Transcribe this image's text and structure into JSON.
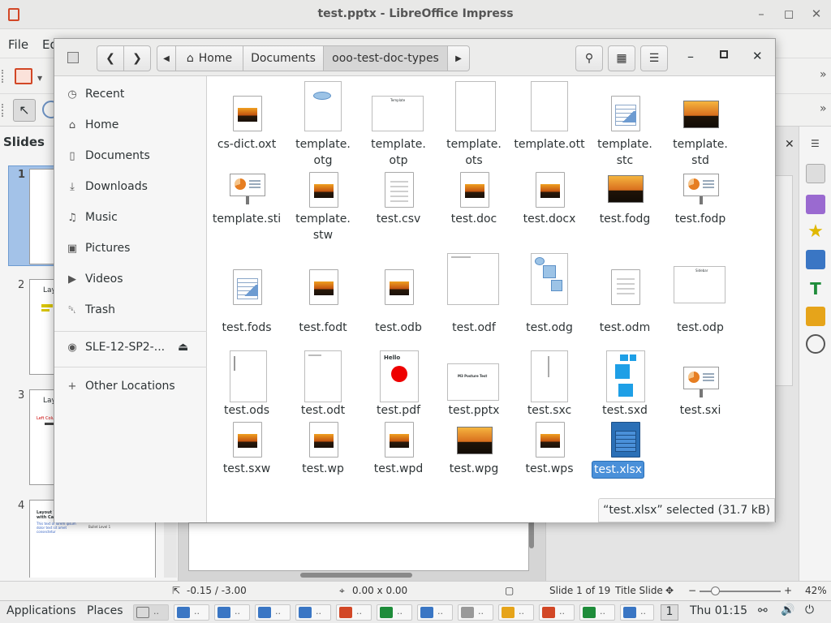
{
  "lo_window": {
    "title": "test.pptx - LibreOffice Impress",
    "menu": {
      "file": "File",
      "edit_partial": "Ed"
    },
    "slides_panel_title": "Slides",
    "slide_numbers": [
      "1",
      "2",
      "3",
      "4"
    ],
    "slide_texts": {
      "s2_title": "Layo",
      "s3_title": "Layo",
      "s3_sub": "Left Column",
      "s4_title": "Layout Test",
      "s4_sub": "with Caption",
      "s4_body": "This text of lorem ipsum dolor text sit amet consectetur",
      "s4_right": "Bullet Level 1"
    },
    "status": {
      "position": "-0.15 / -3.00",
      "size": "0.00 x 0.00",
      "slide": "Slide 1 of 19",
      "layout": "Title Slide",
      "zoom_minus": "−",
      "zoom_plus": "+",
      "zoom": "42%"
    }
  },
  "taskbar": {
    "applications": "Applications",
    "places": "Places",
    "workspace": "1",
    "clock": "Thu 01:15",
    "task_dots": ".."
  },
  "dialog": {
    "path": {
      "home": "Home",
      "documents": "Documents",
      "current": "ooo-test-doc-types"
    },
    "places": [
      {
        "name": "recent",
        "label": "Recent",
        "icon": "clock-icon",
        "glyph": "◷"
      },
      {
        "name": "home",
        "label": "Home",
        "icon": "home-icon",
        "glyph": "⌂"
      },
      {
        "name": "documents",
        "label": "Documents",
        "icon": "document-icon",
        "glyph": "▯"
      },
      {
        "name": "downloads",
        "label": "Downloads",
        "icon": "download-icon",
        "glyph": "⤓"
      },
      {
        "name": "music",
        "label": "Music",
        "icon": "music-icon",
        "glyph": "♫"
      },
      {
        "name": "pictures",
        "label": "Pictures",
        "icon": "camera-icon",
        "glyph": "▣"
      },
      {
        "name": "videos",
        "label": "Videos",
        "icon": "video-icon",
        "glyph": "▶"
      },
      {
        "name": "trash",
        "label": "Trash",
        "icon": "trash-icon",
        "glyph": "␡"
      }
    ],
    "drive": {
      "label": "SLE-12-SP2-...",
      "eject": "⏏"
    },
    "other_locations": {
      "label": "Other Locations",
      "glyph": "+"
    },
    "files": [
      "cs-dict.oxt",
      "template.\notg",
      "template.\notp",
      "template.\nots",
      "template.ott",
      "template.\nstc",
      "template.\nstd",
      "template.sti",
      "template.\nstw",
      "test.csv",
      "test.doc",
      "test.docx",
      "test.fodg",
      "test.fodp",
      "test.fods",
      "test.fodt",
      "test.odb",
      "test.odf",
      "test.odg",
      "test.odm",
      "test.odp",
      "test.ods",
      "test.odt",
      "test.pdf",
      "test.pptx",
      "test.sxc",
      "test.sxd",
      "test.sxi",
      "test.sxw",
      "test.wp",
      "test.wpd",
      "test.wpg",
      "test.wps",
      "test.xlsx"
    ],
    "thumb_texts": {
      "otp_title": "Template",
      "pdf_hello": "Hello",
      "pptx_title": "M3 Posture Test",
      "odp_title": "Sidebar"
    },
    "selected_status": "“test.xlsx” selected  (31.7 kB)"
  },
  "colors": {
    "selection": "#4a90d9",
    "ppt_orange": "#d24726",
    "calc_green": "#1e8c3a"
  }
}
